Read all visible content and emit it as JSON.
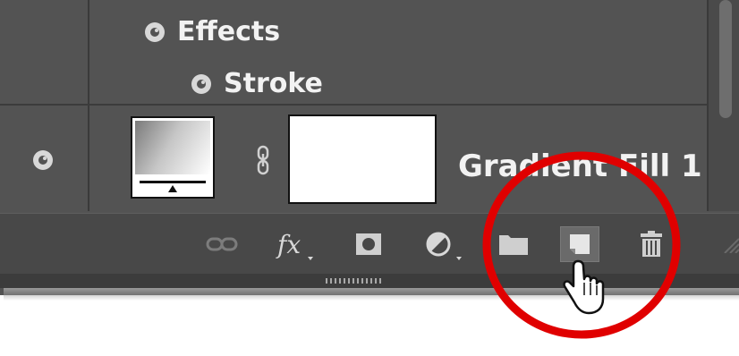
{
  "layers_panel": {
    "effects_row": {
      "label": "Effects",
      "icon": "eye-icon"
    },
    "stroke_row": {
      "label": "Stroke",
      "icon": "eye-icon"
    },
    "layer": {
      "name": "Gradient Fill 1",
      "thumbnail": "gradient-fill-thumbnail",
      "mask": "layer-mask-thumbnail"
    },
    "toolbar": {
      "buttons": [
        {
          "name": "link-layers",
          "icon": "link-icon"
        },
        {
          "name": "layer-style",
          "icon": "fx-icon"
        },
        {
          "name": "add-layer-mask",
          "icon": "mask-icon"
        },
        {
          "name": "new-fill-or-adjustment-layer",
          "icon": "half-circle-icon"
        },
        {
          "name": "new-group",
          "icon": "folder-icon"
        },
        {
          "name": "create-new-layer",
          "icon": "new-layer-icon",
          "state": "hover"
        },
        {
          "name": "delete-layer",
          "icon": "trash-icon"
        }
      ],
      "highlight_color": "#e00000"
    }
  },
  "colors": {
    "panel_bg": "#535353",
    "toolbar_bg": "#484848",
    "text": "#f2f2f2",
    "highlight": "#e00000"
  }
}
